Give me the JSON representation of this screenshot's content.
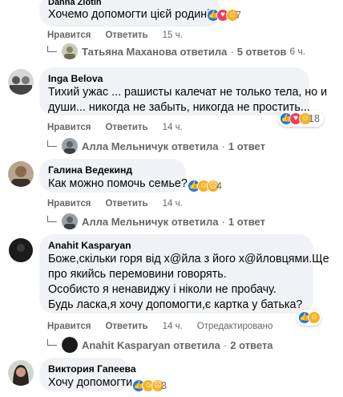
{
  "comments": [
    {
      "author": "Danna Zlotin",
      "lines": [
        "Хочемо допомогти цієй родині"
      ],
      "reaction_count": "7",
      "actions": {
        "like": "Нравится",
        "reply": "Ответить",
        "time": "15 ч."
      },
      "reply": {
        "name": "Татьяна Маханова",
        "verb": "ответила",
        "sep": "·",
        "count": "5 ответов",
        "time": "6 ч."
      }
    },
    {
      "author": "Inga Belova",
      "lines": [
        "Тихий ужас ... рашисты калечат не только тела, но и",
        "души... никогда не забыть, никогда не простить..."
      ],
      "reaction_count": "18",
      "actions": {
        "like": "Нравится",
        "reply": "Ответить",
        "time": "14 ч."
      },
      "reply": {
        "name": "Алла Мельничук",
        "verb": "ответила",
        "sep": "·",
        "count": "1 ответ"
      }
    },
    {
      "author": "Галина Ведекинд",
      "lines": [
        "Как можно помочь семье?"
      ],
      "reaction_count": "4",
      "actions": {
        "like": "Нравится",
        "reply": "Ответить",
        "time": "14 ч."
      },
      "reply": {
        "name": "Алла Мельничук",
        "verb": "ответила",
        "sep": "·",
        "count": "1 ответ"
      }
    },
    {
      "author": "Anahit Kasparyan",
      "lines": [
        "Боже,скільки горя від х@йла з його х@йловцями.Ще",
        "про якийсь перемовини говорять.",
        "Особисто я ненавиджу і ніколи не пробачу.",
        "Будь ласка,я хочу допомогти,є картка у батька?"
      ],
      "reaction_count": "",
      "actions": {
        "like": "Нравится",
        "reply": "Ответить",
        "time": "14 ч.",
        "edited": "Отредактировано"
      },
      "reply": {
        "name": "Anahit Kasparyan",
        "verb": "ответила",
        "sep": "·",
        "count": "2 ответа"
      }
    },
    {
      "author": "Виктория Гапеева",
      "lines": [
        "Хочу допомогти"
      ],
      "reaction_count": "3"
    }
  ],
  "colors": {
    "bubble": "#f0f2f5",
    "muted": "#65676b",
    "like": "#1877f2",
    "love": "#f33e58",
    "care": "#f7b125"
  }
}
